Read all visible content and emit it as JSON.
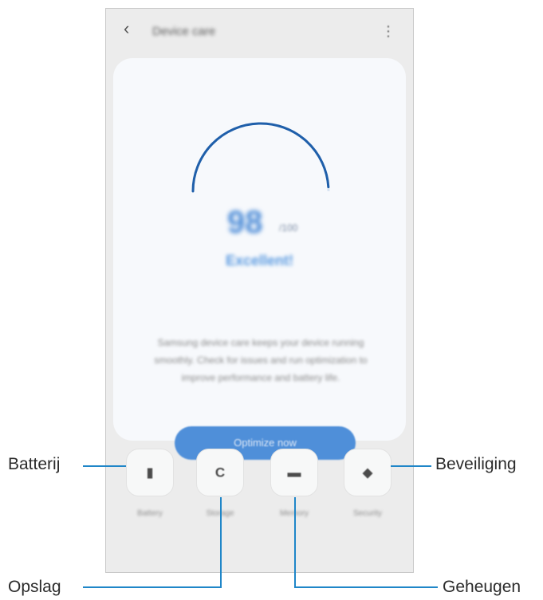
{
  "screen": {
    "title": "Device care",
    "back_icon": "back-arrow-icon",
    "more_icon": "more-options-icon"
  },
  "score": {
    "value": "98",
    "max": "/100",
    "status": "Excellent!",
    "gauge_fraction": 0.98
  },
  "description": "Samsung device care keeps your device running smoothly. Check for issues and run optimization to improve performance and battery life.",
  "optimize_button": "Optimize now",
  "tiles": [
    {
      "id": "battery",
      "icon": "battery-icon",
      "label": "Battery"
    },
    {
      "id": "storage",
      "icon": "storage-icon",
      "label": "Storage"
    },
    {
      "id": "memory",
      "icon": "memory-icon",
      "label": "Memory"
    },
    {
      "id": "security",
      "icon": "shield-icon",
      "label": "Security"
    }
  ],
  "callouts": {
    "battery": "Batterij",
    "storage": "Opslag",
    "memory": "Geheugen",
    "security": "Beveiliging"
  },
  "colors": {
    "accent": "#4f8fd9",
    "callout_line": "#1f86c8",
    "background": "#ececec",
    "card": "#f7f9fc"
  }
}
